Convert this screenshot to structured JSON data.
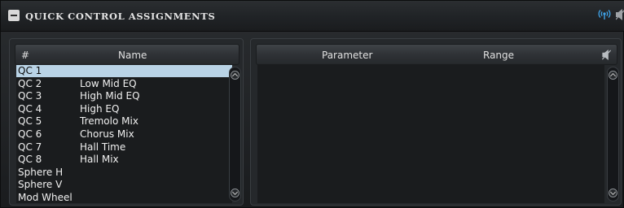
{
  "title_bar": {
    "title": "QUICK CONTROL ASSIGNMENTS",
    "collapse_icon": "minus-square-icon",
    "broadcast_icon": "broadcast-icon",
    "mute_icon": "speaker-mute-icon"
  },
  "left_list": {
    "headers": {
      "number": "#",
      "name": "Name"
    },
    "rows": [
      {
        "qc": "QC 1",
        "name": "",
        "selected": true
      },
      {
        "qc": "QC 2",
        "name": "Low Mid EQ"
      },
      {
        "qc": "QC 3",
        "name": "High Mid EQ"
      },
      {
        "qc": "QC 4",
        "name": "High EQ"
      },
      {
        "qc": "QC 5",
        "name": "Tremolo Mix"
      },
      {
        "qc": "QC 6",
        "name": "Chorus Mix"
      },
      {
        "qc": "QC 7",
        "name": "Hall Time"
      },
      {
        "qc": "QC 8",
        "name": "Hall Mix"
      },
      {
        "qc": "Sphere H",
        "name": ""
      },
      {
        "qc": "Sphere V",
        "name": ""
      },
      {
        "qc": "Mod Wheel",
        "name": ""
      }
    ]
  },
  "right_list": {
    "headers": {
      "parameter": "Parameter",
      "range": "Range"
    },
    "header_icon": "speaker-mute-icon",
    "rows": []
  },
  "colors": {
    "accent_blue": "#3fa3e8",
    "selection": "#b9d3e6",
    "background": "#1c1e20"
  }
}
